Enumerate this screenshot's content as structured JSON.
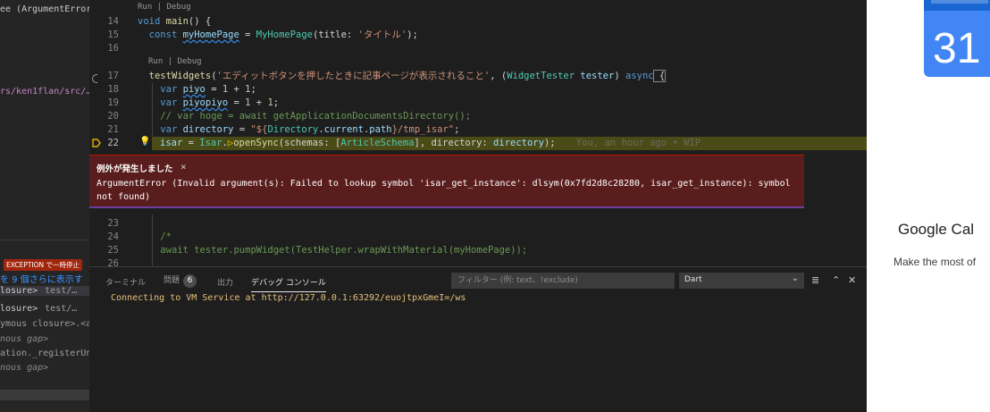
{
  "sidebar": {
    "top_text": "ee (ArgumentError)",
    "path_text": "rs/ken1flan/src/…",
    "exception_badge": "EXCEPTION で一時停止",
    "more_frames": "を 9 個さらに表示す",
    "frames": [
      {
        "name": "losure>",
        "file": "test/…",
        "selected": true
      },
      {
        "name": "losure>",
        "file": "test/…",
        "selected": false
      }
    ],
    "anon_frame": "ymous closure>.<an",
    "gap1": "nous gap>",
    "registered": "ation._registerUna",
    "gap2": "nous gap>"
  },
  "editor": {
    "codelens_main": "Run | Debug",
    "codelens_test": "Run | Debug",
    "lines": {
      "l14": "14",
      "l15": "15",
      "l16": "16",
      "l17": "17",
      "l18": "18",
      "l19": "19",
      "l20": "20",
      "l21": "21",
      "l22": "22",
      "l23": "23",
      "l24": "24",
      "l25": "25",
      "l26": "26"
    },
    "code": {
      "c14_kw": "void",
      "c14_fn": "main",
      "c14_rest": "() {",
      "c15_kw": "const",
      "c15_var": "myHomePage",
      "c15_eq": " = ",
      "c15_ty": "MyHomePage",
      "c15_open": "(title: ",
      "c15_str": "'タイトル'",
      "c15_close": ");",
      "c17_fn": "testWidgets",
      "c17_open": "(",
      "c17_str": "'エディットボタンを押したときに記事ページが表示されること'",
      "c17_mid": ", (",
      "c17_ty": "WidgetTester",
      "c17_var": "tester",
      "c17_close": ") ",
      "c17_kw": "async",
      "c17_brace": " {",
      "c18_kw": "var",
      "c18_var": "piyo",
      "c18_eq": " = ",
      "c18_n1": "1",
      "c18_plus": " + ",
      "c18_n2": "1",
      "c18_end": ";",
      "c19_kw": "var",
      "c19_var": "piyopiyo",
      "c19_eq": " = ",
      "c19_n1": "1",
      "c19_plus": " + ",
      "c19_n2": "1",
      "c19_end": ";",
      "c20_cm": "// var hoge = await getApplicationDocumentsDirectory();",
      "c21_kw": "var",
      "c21_var": "directory",
      "c21_eq": " = ",
      "c21_str1": "\"${",
      "c21_ty": "Directory",
      "c21_dot": ".",
      "c21_v2": "current",
      "c21_dot2": ".",
      "c21_v3": "path",
      "c21_str2": "}/tmp_isar\"",
      "c21_end": ";",
      "c22_var": "isar",
      "c22_eq": " = ",
      "c22_ty": "Isar",
      "c22_dot": ".",
      "c22_fn": "openSync",
      "c22_open": "(schemas: [",
      "c22_ty2": "ArticleSchema",
      "c22_mid": "], directory: ",
      "c22_var2": "directory",
      "c22_end": ");",
      "c22_blame": "You, an hour ago • WIP",
      "c24_cm": "/*",
      "c25_cm": "await tester.pumpWidget(TestHelper.wrapWithMaterial(myHomePage));"
    },
    "exception": {
      "title": "例外が発生しました",
      "close": "×",
      "message": "ArgumentError (Invalid argument(s): Failed to lookup symbol 'isar_get_instance': dlsym(0x7fd2d8c28280, isar_get_instance): symbol not found)"
    }
  },
  "panel": {
    "tabs": [
      {
        "label": "ターミナル"
      },
      {
        "label": "問題",
        "badge": "6"
      },
      {
        "label": "出力"
      },
      {
        "label": "デバッグ コンソール"
      }
    ],
    "filter_placeholder": "フィルター (例: text、!exclude)",
    "dart_select": "Dart",
    "console_output": "Connecting to VM Service at http://127.0.0.1:63292/euojtpxGmeI=/ws"
  },
  "browser": {
    "calendar_day": "31",
    "title": "Google Cal",
    "subtitle": "Make the most of"
  },
  "colors": {
    "editor_bg": "#1e1e1e",
    "exception_bg": "#5a1d1d",
    "highlight_line": "#4b4b18",
    "calendar_blue": "#4285f4"
  }
}
